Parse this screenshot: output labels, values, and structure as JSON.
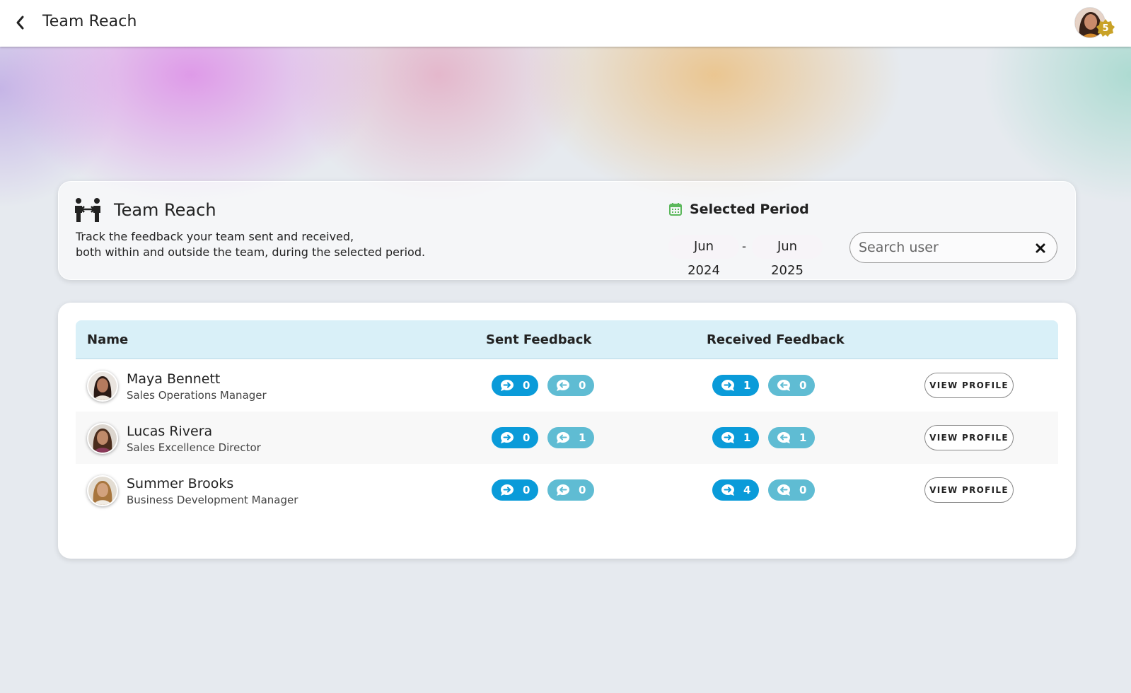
{
  "header": {
    "title": "Team Reach",
    "notification_count": "5"
  },
  "summary": {
    "title": "Team Reach",
    "description_line1": "Track the feedback your team sent and received,",
    "description_line2": "both within and outside the team, during the selected period.",
    "period_label": "Selected Period",
    "period_start": "Jun 2024",
    "period_separator": "-",
    "period_end": "Jun 2025",
    "search_placeholder": "Search user"
  },
  "table": {
    "headers": {
      "name": "Name",
      "sent": "Sent Feedback",
      "received": "Received Feedback"
    },
    "view_profile_label": "VIEW PROFILE",
    "rows": [
      {
        "name": "Maya Bennett",
        "role": "Sales Operations Manager",
        "sent_out": "0",
        "sent_in": "0",
        "recv_out": "1",
        "recv_in": "0"
      },
      {
        "name": "Lucas Rivera",
        "role": "Sales Excellence Director",
        "sent_out": "0",
        "sent_in": "1",
        "recv_out": "1",
        "recv_in": "1"
      },
      {
        "name": "Summer Brooks",
        "role": "Business Development Manager",
        "sent_out": "0",
        "sent_in": "0",
        "recv_out": "4",
        "recv_in": "0"
      }
    ]
  },
  "colors": {
    "pill_dark": "#0a9bd9",
    "pill_light": "#5fbcd3",
    "table_header_bg": "#d9f0f8",
    "calendar_icon": "#5cb85c",
    "badge_gold": "#c9a227"
  },
  "icons": {
    "back": "chevron-left-icon",
    "user_avatar": "avatar",
    "badge": "star-badge-icon",
    "team_reach": "people-exchange-icon",
    "calendar": "calendar-icon",
    "clear": "close-icon",
    "sent_feedback": "chat-arrow-right-icon",
    "received_feedback": "chat-arrow-left-icon"
  }
}
